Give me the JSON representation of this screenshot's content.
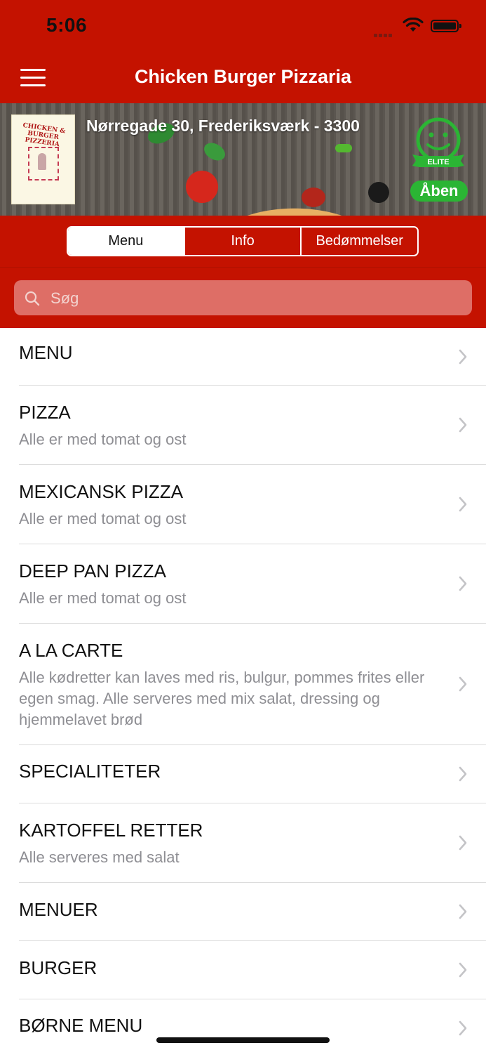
{
  "status": {
    "time": "5:06"
  },
  "nav": {
    "title": "Chicken Burger Pizzaria"
  },
  "hero": {
    "address": "Nørregade 30, Frederiksværk - 3300",
    "logo_text": "CHICKEN & BURGER PIZZERIA",
    "rating_label": "ELITE",
    "open_status": "Åben"
  },
  "tabs": {
    "items": [
      "Menu",
      "Info",
      "Bedømmelser"
    ],
    "active": "Menu"
  },
  "search": {
    "placeholder": "Søg"
  },
  "colors": {
    "brand_red": "#c41200",
    "open_green": "#2bb534",
    "subtitle_gray": "#8e8e93"
  },
  "categories": [
    {
      "title": "MENU",
      "subtitle": ""
    },
    {
      "title": "PIZZA",
      "subtitle": "Alle er med tomat og ost"
    },
    {
      "title": "MEXICANSK PIZZA",
      "subtitle": "Alle er med tomat og ost"
    },
    {
      "title": "DEEP PAN PIZZA",
      "subtitle": "Alle er med tomat og ost"
    },
    {
      "title": "A LA CARTE",
      "subtitle": "Alle kødretter kan laves med ris, bulgur, pommes frites eller egen smag. Alle serveres med mix salat, dressing og hjemmelavet brød"
    },
    {
      "title": "SPECIALITETER",
      "subtitle": ""
    },
    {
      "title": "KARTOFFEL RETTER",
      "subtitle": "Alle serveres med salat"
    },
    {
      "title": "MENUER",
      "subtitle": ""
    },
    {
      "title": "BURGER",
      "subtitle": ""
    },
    {
      "title": "BØRNE MENU",
      "subtitle": ""
    }
  ]
}
